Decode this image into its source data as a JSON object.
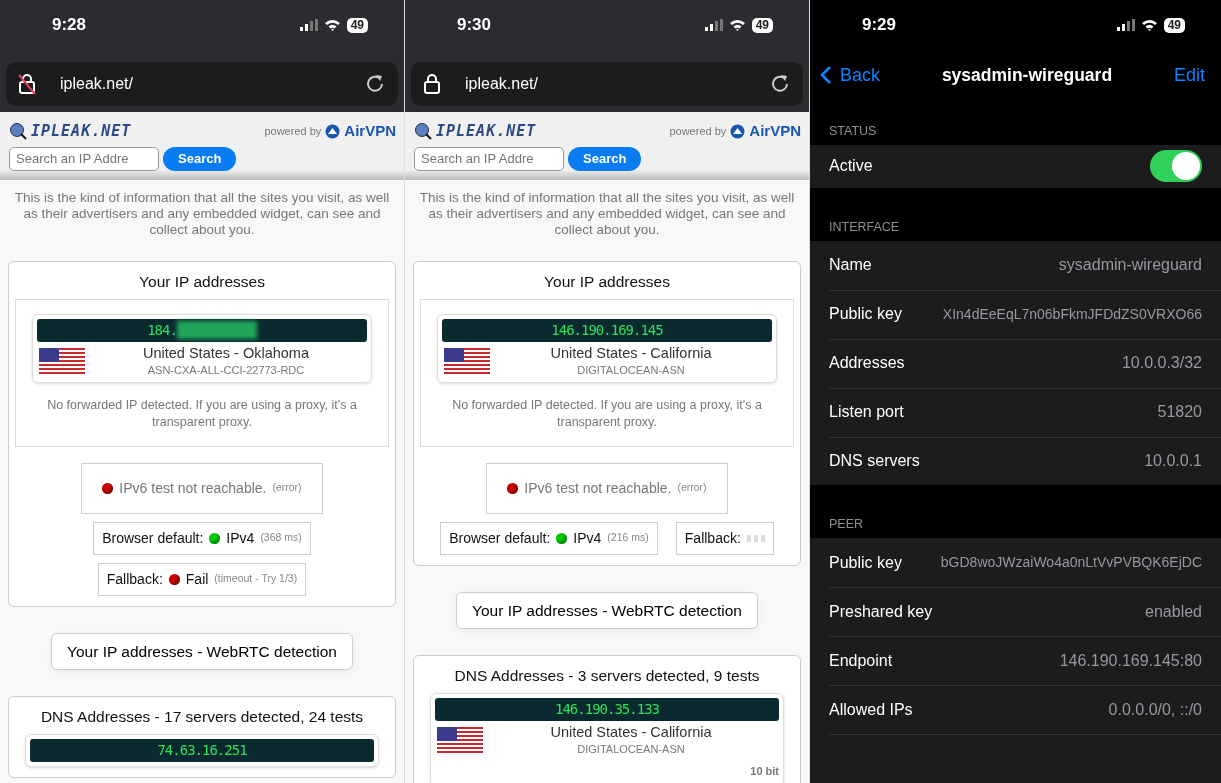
{
  "phones": [
    {
      "kind": "browser",
      "status_bar": {
        "time": "9:28",
        "battery": "49"
      },
      "address_bar": {
        "secure": false,
        "url": "ipleak.net/"
      },
      "site": {
        "logo": "IPLEAK.NET",
        "powered_by": "powered by",
        "brand": "AirVPN",
        "search": {
          "placeholder": "Search an IP Addre",
          "button": "Search"
        },
        "intro": "This is the kind of information that all the sites you visit, as well as their advertisers and any embedded widget, can see and collect about you.",
        "ip_card": {
          "title": "Your IP addresses",
          "ip": {
            "address": "184.",
            "masked": true,
            "location": "United States - Oklahoma",
            "asn": "ASN-CXA-ALL-CCI-22773-RDC"
          },
          "forward_note": "No forwarded IP detected. If you are using a proxy, it's a transparent proxy.",
          "ipv6": {
            "text": "IPv6 test not reachable.",
            "note": "(error)",
            "color": "#cc0000"
          },
          "tests": [
            {
              "label": "Browser default:",
              "kind": "result",
              "color": "#00cc00",
              "value": "IPv4",
              "note": "(368 ms)"
            },
            {
              "label": "Fallback:",
              "kind": "result",
              "color": "#cc0000",
              "value": "Fail",
              "note": "(timeout - Try 1/3)"
            }
          ]
        },
        "webrtc_button": "Your IP addresses - WebRTC detection",
        "dns_card": {
          "title": "DNS Addresses - 17 servers detected, 24 tests",
          "ips": [
            {
              "address": "74.63.16.251",
              "masked": false
            }
          ]
        }
      }
    },
    {
      "kind": "browser",
      "status_bar": {
        "time": "9:30",
        "battery": "49"
      },
      "address_bar": {
        "secure": true,
        "url": "ipleak.net/"
      },
      "site": {
        "logo": "IPLEAK.NET",
        "powered_by": "powered by",
        "brand": "AirVPN",
        "search": {
          "placeholder": "Search an IP Addre",
          "button": "Search"
        },
        "intro": "This is the kind of information that all the sites you visit, as well as their advertisers and any embedded widget, can see and collect about you.",
        "ip_card": {
          "title": "Your IP addresses",
          "ip": {
            "address": "146.190.169.145",
            "masked": false,
            "location": "United States - California",
            "asn": "DIGITALOCEAN-ASN"
          },
          "forward_note": "No forwarded IP detected. If you are using a proxy, it's a transparent proxy.",
          "ipv6": {
            "text": "IPv6 test not reachable.",
            "note": "(error)",
            "color": "#cc0000"
          },
          "tests": [
            {
              "label": "Browser default:",
              "kind": "result",
              "color": "#00cc00",
              "value": "IPv4",
              "note": "(216 ms)"
            },
            {
              "label": "Fallback:",
              "kind": "pending"
            }
          ]
        },
        "webrtc_button": "Your IP addresses - WebRTC detection",
        "dns_card": {
          "title": "DNS Addresses - 3 servers detected, 9 tests",
          "ips": [
            {
              "address": "146.190.35.133",
              "masked": false,
              "location": "United States - California",
              "asn": "DIGITALOCEAN-ASN",
              "bits": "10 bit"
            }
          ]
        }
      }
    },
    {
      "kind": "settings",
      "status_bar": {
        "time": "9:29",
        "battery": "49"
      },
      "nav": {
        "back": "Back",
        "title": "sysadmin-wireguard",
        "action": "Edit"
      },
      "sections": [
        {
          "header": "STATUS",
          "rows": [
            {
              "kind": "toggle",
              "label": "Active",
              "on": true
            }
          ]
        },
        {
          "header": "INTERFACE",
          "rows": [
            {
              "kind": "value",
              "label": "Name",
              "value": "sysadmin-wireguard"
            },
            {
              "kind": "value",
              "label": "Public key",
              "value": "XIn4dEeEqL7n06bFkmJFDdZS0VRXO66"
            },
            {
              "kind": "value",
              "label": "Addresses",
              "value": "10.0.0.3/32"
            },
            {
              "kind": "value",
              "label": "Listen port",
              "value": "51820"
            },
            {
              "kind": "value",
              "label": "DNS servers",
              "value": "10.0.0.1"
            }
          ]
        },
        {
          "header": "PEER",
          "rows": [
            {
              "kind": "value",
              "label": "Public key",
              "value": "bGD8woJWzaiWo4a0nLtVvPVBQK6EjDC"
            },
            {
              "kind": "value",
              "label": "Preshared key",
              "value": "enabled"
            },
            {
              "kind": "value",
              "label": "Endpoint",
              "value": "146.190.169.145:80"
            },
            {
              "kind": "value",
              "label": "Allowed IPs",
              "value": "0.0.0.0/0, ::/0"
            }
          ]
        }
      ]
    }
  ]
}
